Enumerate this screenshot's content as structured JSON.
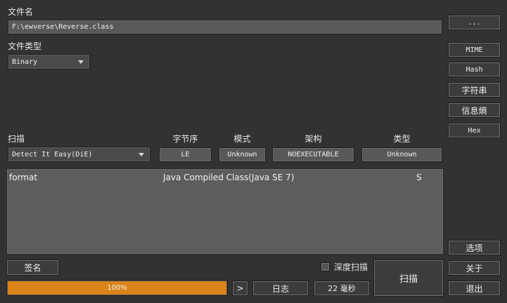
{
  "file": {
    "label": "文件名",
    "path": "F:\\ewverse\\Reverse.class",
    "browse_label": "..."
  },
  "file_type": {
    "label": "文件类型",
    "selected": "Binary"
  },
  "side_buttons": {
    "mime": "MIME",
    "hash": "Hash",
    "strings": "字符串",
    "entropy": "信息熵",
    "hex": "Hex"
  },
  "scan": {
    "label": "扫描",
    "engine": "Detect It Easy(DiE)",
    "endianness_label": "字节序",
    "endianness": "LE",
    "mode_label": "模式",
    "mode": "Unknown",
    "arch_label": "架构",
    "arch": "NOEXECUTABLE",
    "type_label": "类型",
    "type": "Unknown"
  },
  "results": [
    {
      "kind": "format",
      "name": "Java Compiled Class(Java SE 7)",
      "flag": "S"
    }
  ],
  "bottom": {
    "signatures_label": "签名",
    "deep_scan_label": "深度扫描",
    "deep_scan_checked": false,
    "scan_button": "扫描",
    "progress_percent": 100,
    "progress_text": "100%",
    "next_label": ">",
    "log_label": "日志",
    "elapsed": "22 毫秒",
    "options_label": "选项",
    "about_label": "关于",
    "exit_label": "退出"
  },
  "colors": {
    "background": "#323232",
    "progress": "#d98319"
  }
}
